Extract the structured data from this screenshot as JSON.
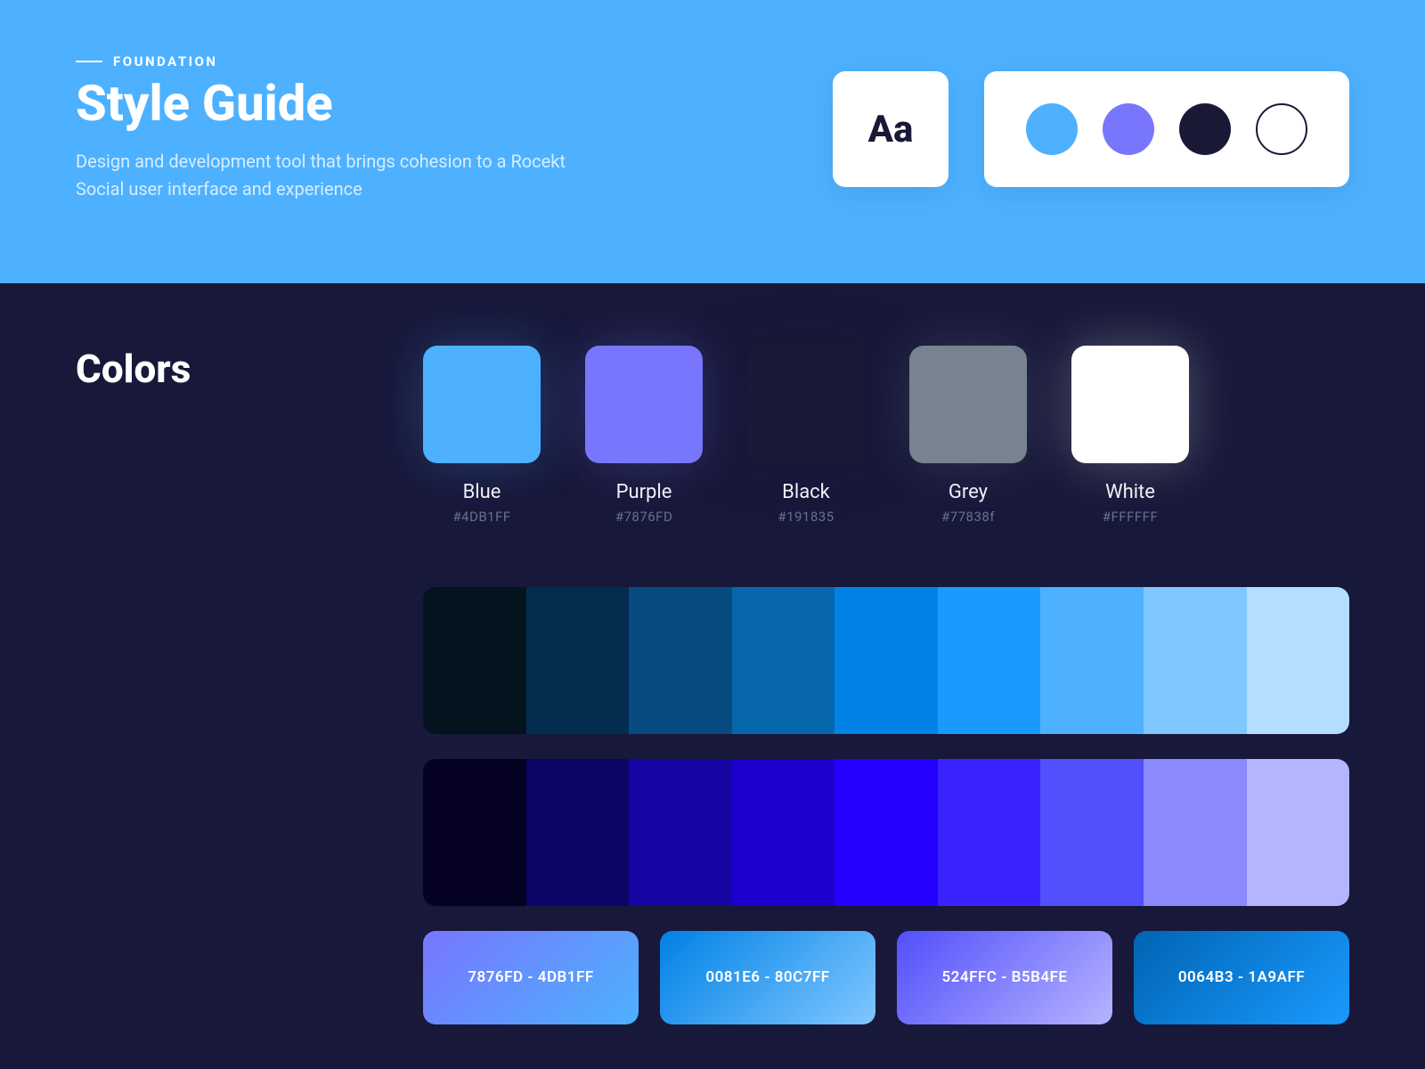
{
  "hero": {
    "eyebrow": "FOUNDATION",
    "title": "Style Guide",
    "subtitle": "Design and development tool that brings cohesion to a Rocekt Social user interface and experience",
    "aa_label": "Aa",
    "preview_colors": [
      "#4DB1FF",
      "#7876FD",
      "#191835",
      "outline"
    ]
  },
  "section": {
    "title": "Colors"
  },
  "swatches": [
    {
      "name": "Blue",
      "hex": "#4DB1FF",
      "class": "swatch-blue"
    },
    {
      "name": "Purple",
      "hex": "#7876FD",
      "class": "swatch-purple"
    },
    {
      "name": "Black",
      "hex": "#191835",
      "class": "swatch-black"
    },
    {
      "name": "Grey",
      "hex": "#77838f",
      "class": "swatch-grey"
    },
    {
      "name": "White",
      "hex": "#FFFFFF",
      "class": "swatch-white"
    }
  ],
  "ramps": [
    [
      "#04141f",
      "#032c4f",
      "#064a7f",
      "#0667ab",
      "#0081E6",
      "#1a9aff",
      "#4db1ff",
      "#80c7ff",
      "#b3deff"
    ],
    [
      "#040122",
      "#0c0566",
      "#1606a3",
      "#1c00cc",
      "#2400ff",
      "#3a23ff",
      "#524ffc",
      "#8a89fd",
      "#b5b4fe"
    ]
  ],
  "gradients": [
    {
      "label": "7876FD - 4DB1FF",
      "from": "#7876FD",
      "to": "#4DB1FF"
    },
    {
      "label": "0081E6 - 80C7FF",
      "from": "#0081E6",
      "to": "#80C7FF"
    },
    {
      "label": "524FFC - B5B4FE",
      "from": "#524FFC",
      "to": "#B5B4FE"
    },
    {
      "label": "0064B3 - 1A9AFF",
      "from": "#0064B3",
      "to": "#1A9AFF"
    }
  ]
}
